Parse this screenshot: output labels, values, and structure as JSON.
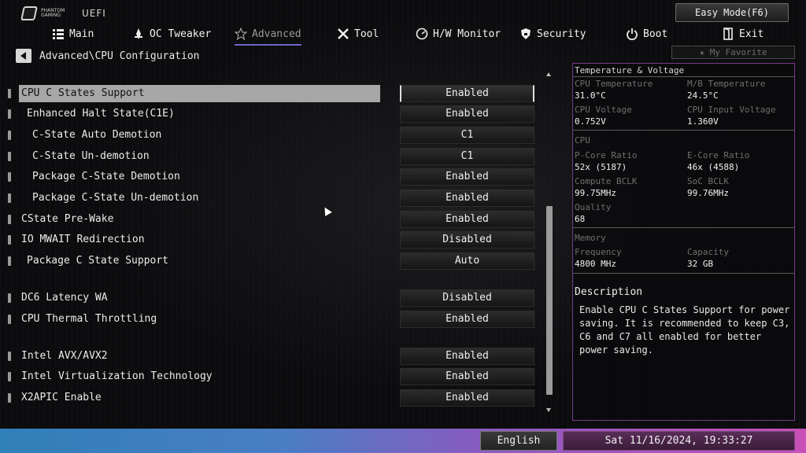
{
  "header": {
    "logo_brand": "PHANTOM GAMING",
    "logo_uefi": "UEFI",
    "easy_mode": "Easy Mode(F6)",
    "my_favorite": "My Favorite"
  },
  "nav": {
    "items": [
      {
        "label": "Main",
        "icon": "list-icon"
      },
      {
        "label": "OC Tweaker",
        "icon": "rocket-icon"
      },
      {
        "label": "Advanced",
        "icon": "star-icon",
        "active": true
      },
      {
        "label": "Tool",
        "icon": "tools-icon"
      },
      {
        "label": "H/W Monitor",
        "icon": "monitor-icon"
      },
      {
        "label": "Security",
        "icon": "shield-icon"
      },
      {
        "label": "Boot",
        "icon": "power-icon"
      },
      {
        "label": "Exit",
        "icon": "exit-icon"
      }
    ]
  },
  "breadcrumb": "Advanced\\CPU Configuration",
  "settings": [
    {
      "label": "CPU C States Support",
      "value": "Enabled",
      "selected": true
    },
    {
      "label": "Enhanced Halt State(C1E)",
      "value": "Enabled"
    },
    {
      "label": "C-State Auto Demotion",
      "value": "C1"
    },
    {
      "label": "C-State Un-demotion",
      "value": "C1"
    },
    {
      "label": "Package C-State Demotion",
      "value": "Enabled"
    },
    {
      "label": "Package C-State Un-demotion",
      "value": "Enabled"
    },
    {
      "label": "CState Pre-Wake",
      "value": "Enabled"
    },
    {
      "label": "IO MWAIT Redirection",
      "value": "Disabled"
    },
    {
      "label": "Package C State Support",
      "value": "Auto"
    },
    {
      "label": "DC6 Latency WA",
      "value": "Disabled"
    },
    {
      "label": "CPU Thermal Throttling",
      "value": "Enabled"
    },
    {
      "label": "Intel AVX/AVX2",
      "value": "Enabled"
    },
    {
      "label": "Intel Virtualization Technology",
      "value": "Enabled"
    },
    {
      "label": "X2APIC Enable",
      "value": "Enabled"
    }
  ],
  "info": {
    "temp_title": "Temperature & Voltage",
    "cpu_temp_label": "CPU Temperature",
    "cpu_temp": "31.0°C",
    "mb_temp_label": "M/B Temperature",
    "mb_temp": "24.5°C",
    "cpu_volt_label": "CPU Voltage",
    "cpu_volt": "0.752V",
    "cpu_input_volt_label": "CPU Input Voltage",
    "cpu_input_volt": "1.360V",
    "cpu_title": "CPU",
    "pcore_label": "P-Core Ratio",
    "pcore": "52x (5187)",
    "ecore_label": "E-Core Ratio",
    "ecore": "46x (4588)",
    "compute_bclk_label": "Compute BCLK",
    "compute_bclk": "99.75MHz",
    "soc_bclk_label": "SoC BCLK",
    "soc_bclk": "99.76MHz",
    "quality_label": "Quality",
    "quality": "68",
    "memory_title": "Memory",
    "freq_label": "Frequency",
    "freq": "4800 MHz",
    "capacity_label": "Capacity",
    "capacity": "32 GB",
    "description_title": "Description",
    "description": "Enable CPU C States Support for power saving. It is recommended to keep C3, C6 and C7 all enabled for better power saving."
  },
  "footer": {
    "language": "English",
    "datetime": "Sat 11/16/2024, 19:33:27"
  }
}
